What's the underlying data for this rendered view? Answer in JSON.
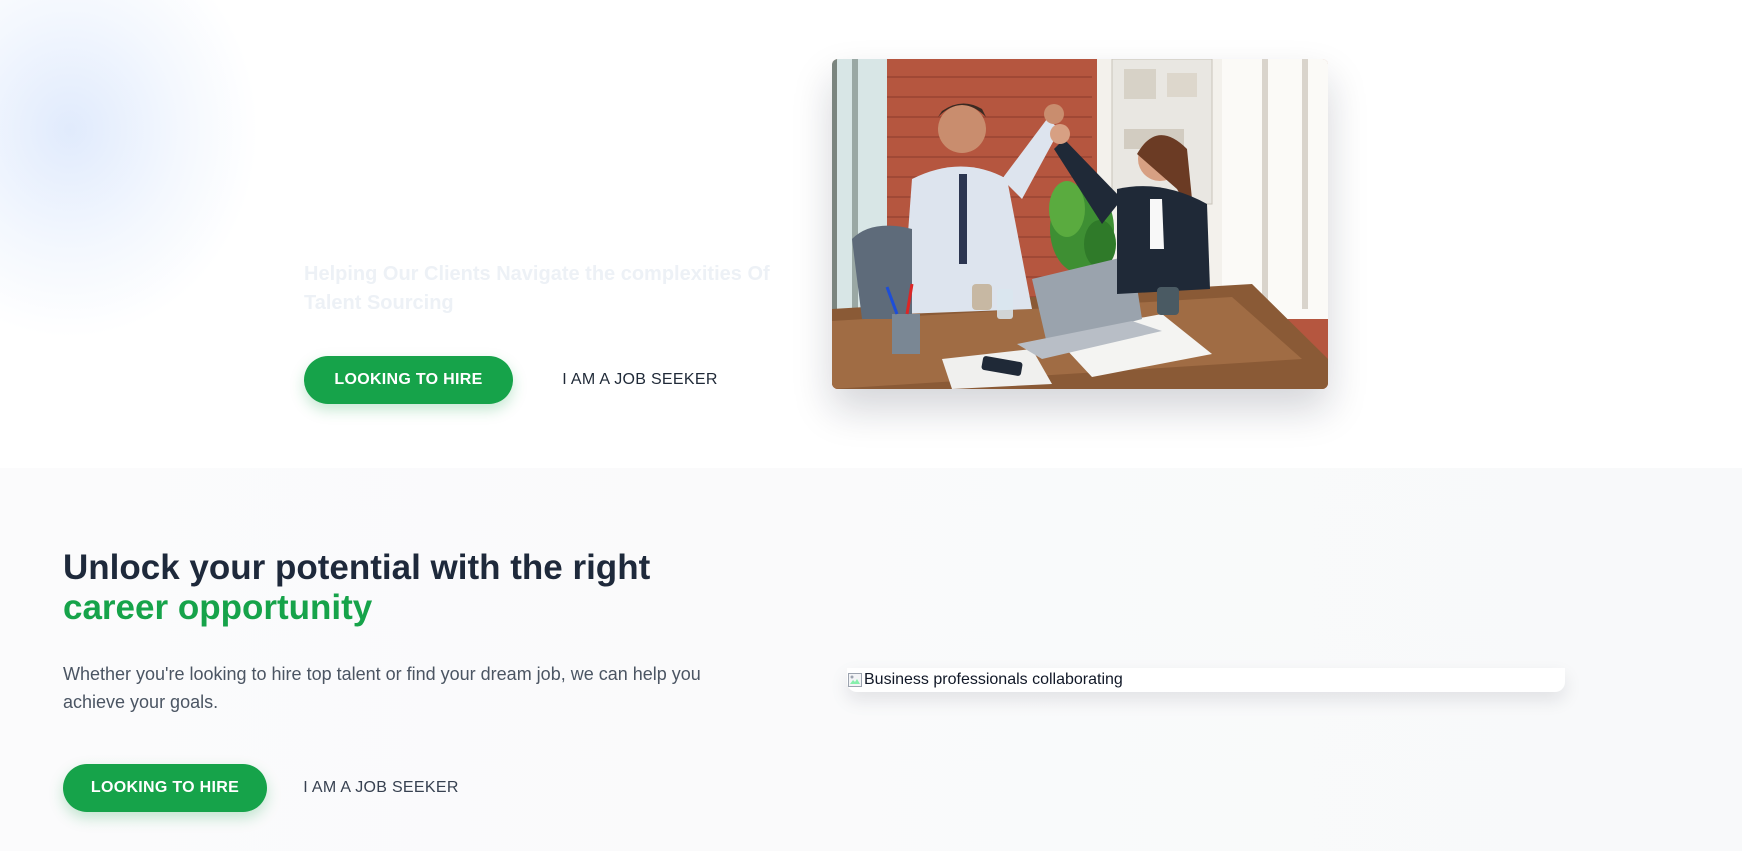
{
  "hero": {
    "subtitle": "Helping Our Clients Navigate the complexities Of Talent Sourcing",
    "primary_button": "LOOKING TO HIRE",
    "secondary_button": "I AM A JOB SEEKER",
    "photo_icon": "office-high-five-photo"
  },
  "section": {
    "title_line1": "Unlock your potential with the right",
    "title_accent": "career opportunity",
    "description": "Whether you're looking to hire top talent or find your dream job, we can help you achieve your goals.",
    "primary_button": "LOOKING TO HIRE",
    "secondary_button": "I AM A JOB SEEKER",
    "image_alt": "Business professionals collaborating",
    "image_icon": "broken-image-icon"
  },
  "colors": {
    "accent": "#16a34a",
    "heading": "#1e293b",
    "body_text": "#4b5563",
    "faded_text": "#edf1f6"
  }
}
